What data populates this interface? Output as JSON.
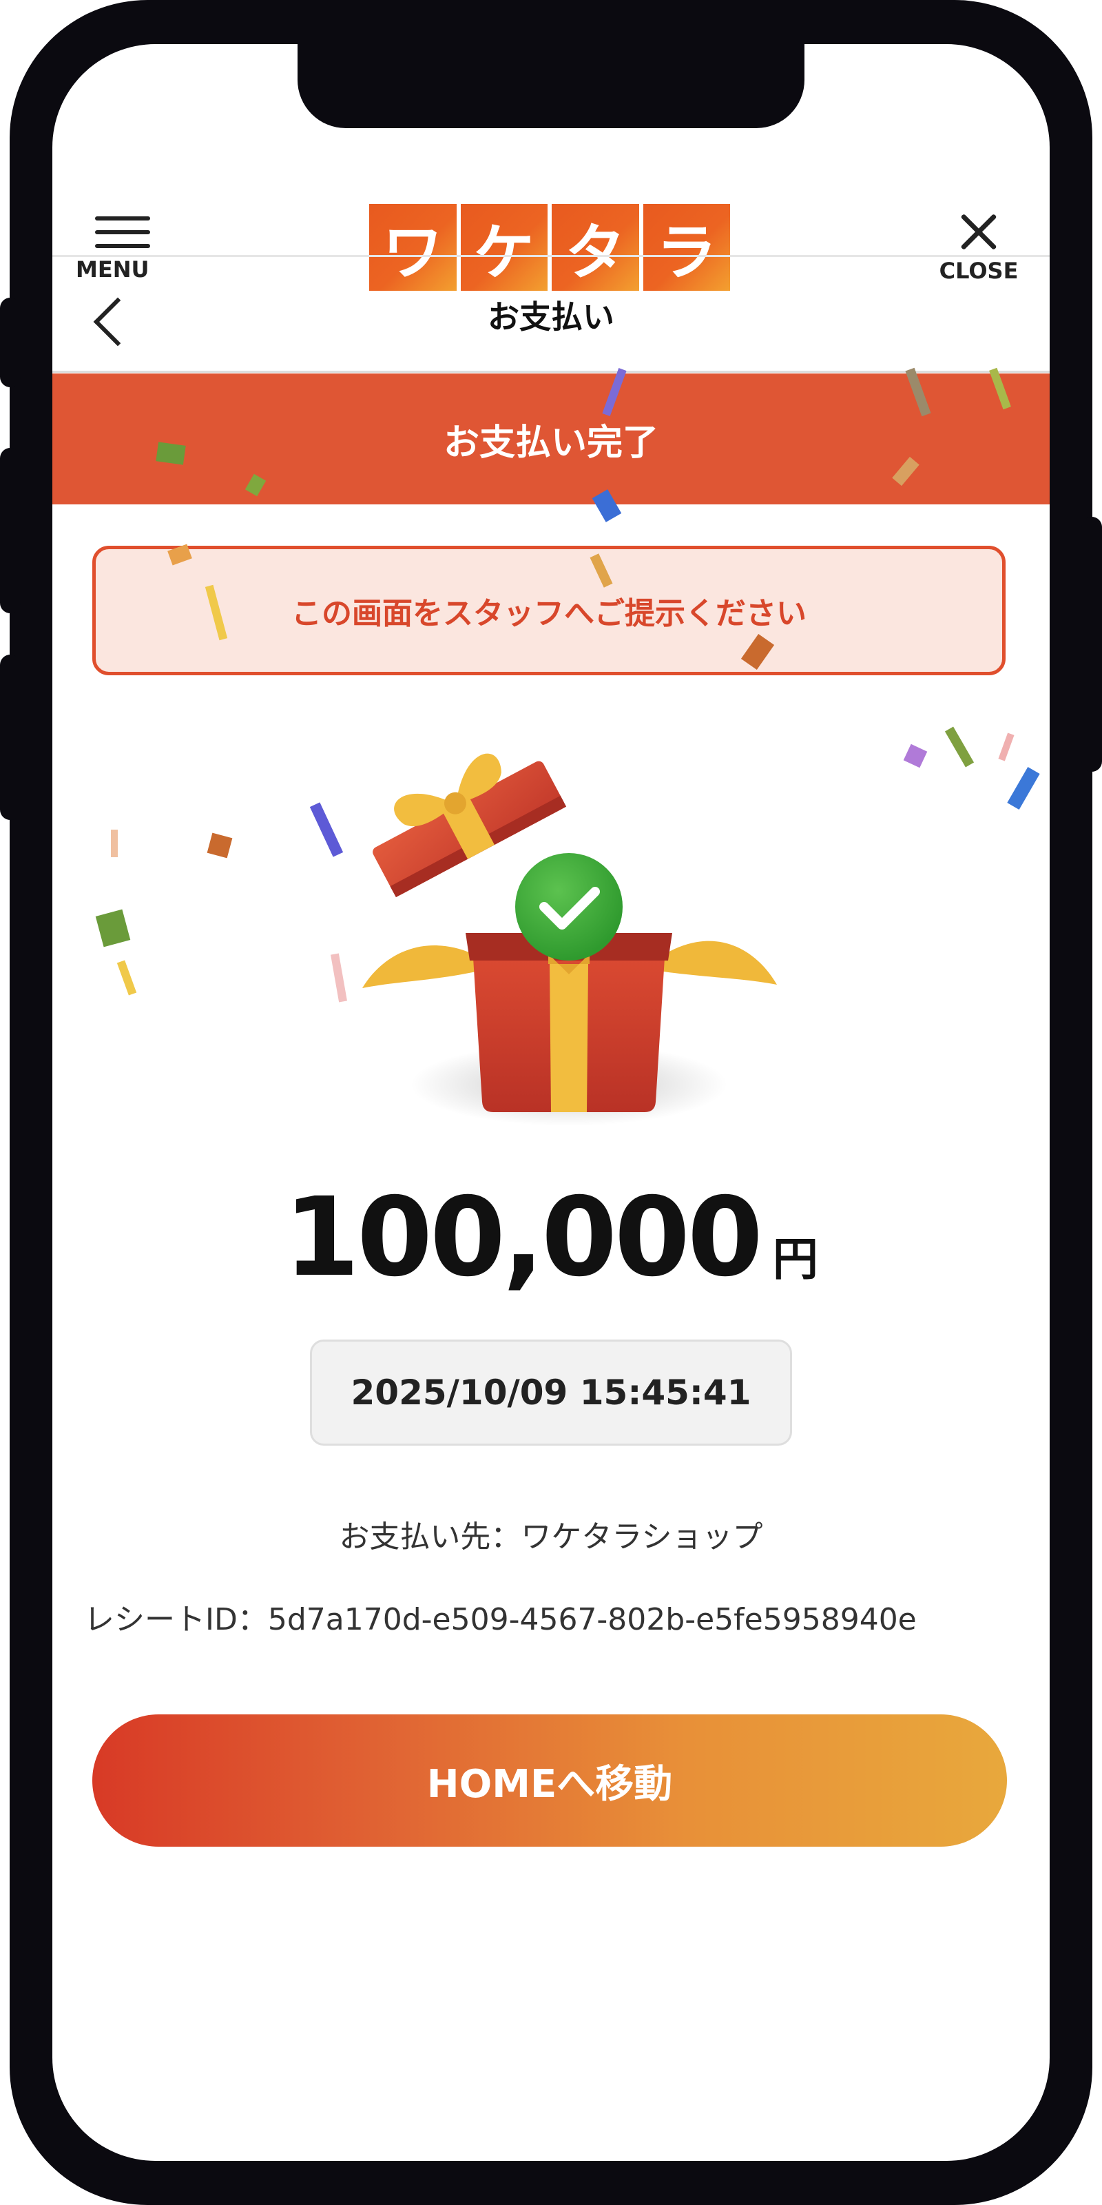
{
  "header": {
    "menu_label": "MENU",
    "logo_chars": [
      "ワ",
      "ケ",
      "タ",
      "ラ"
    ],
    "close_label": "CLOSE"
  },
  "subnav": {
    "title": "お支払い"
  },
  "banner": {
    "text": "お支払い完了"
  },
  "notice": {
    "text": "この画面をスタッフへご提示ください"
  },
  "payment": {
    "amount": "100,000",
    "unit": "円",
    "datetime": "2025/10/09 15:45:41",
    "payee": "お支払い先：ワケタラショップ",
    "receipt": "レシートID：5d7a170d-e509-4567-802b-e5fe5958940e"
  },
  "actions": {
    "home_label": "HOMEへ移動"
  },
  "colors": {
    "brand_orange": "#df5634",
    "notice_bg": "#fbe6df",
    "success_green": "#3fae3a",
    "gift_red": "#d2432e",
    "ribbon_gold": "#f0b83a"
  }
}
